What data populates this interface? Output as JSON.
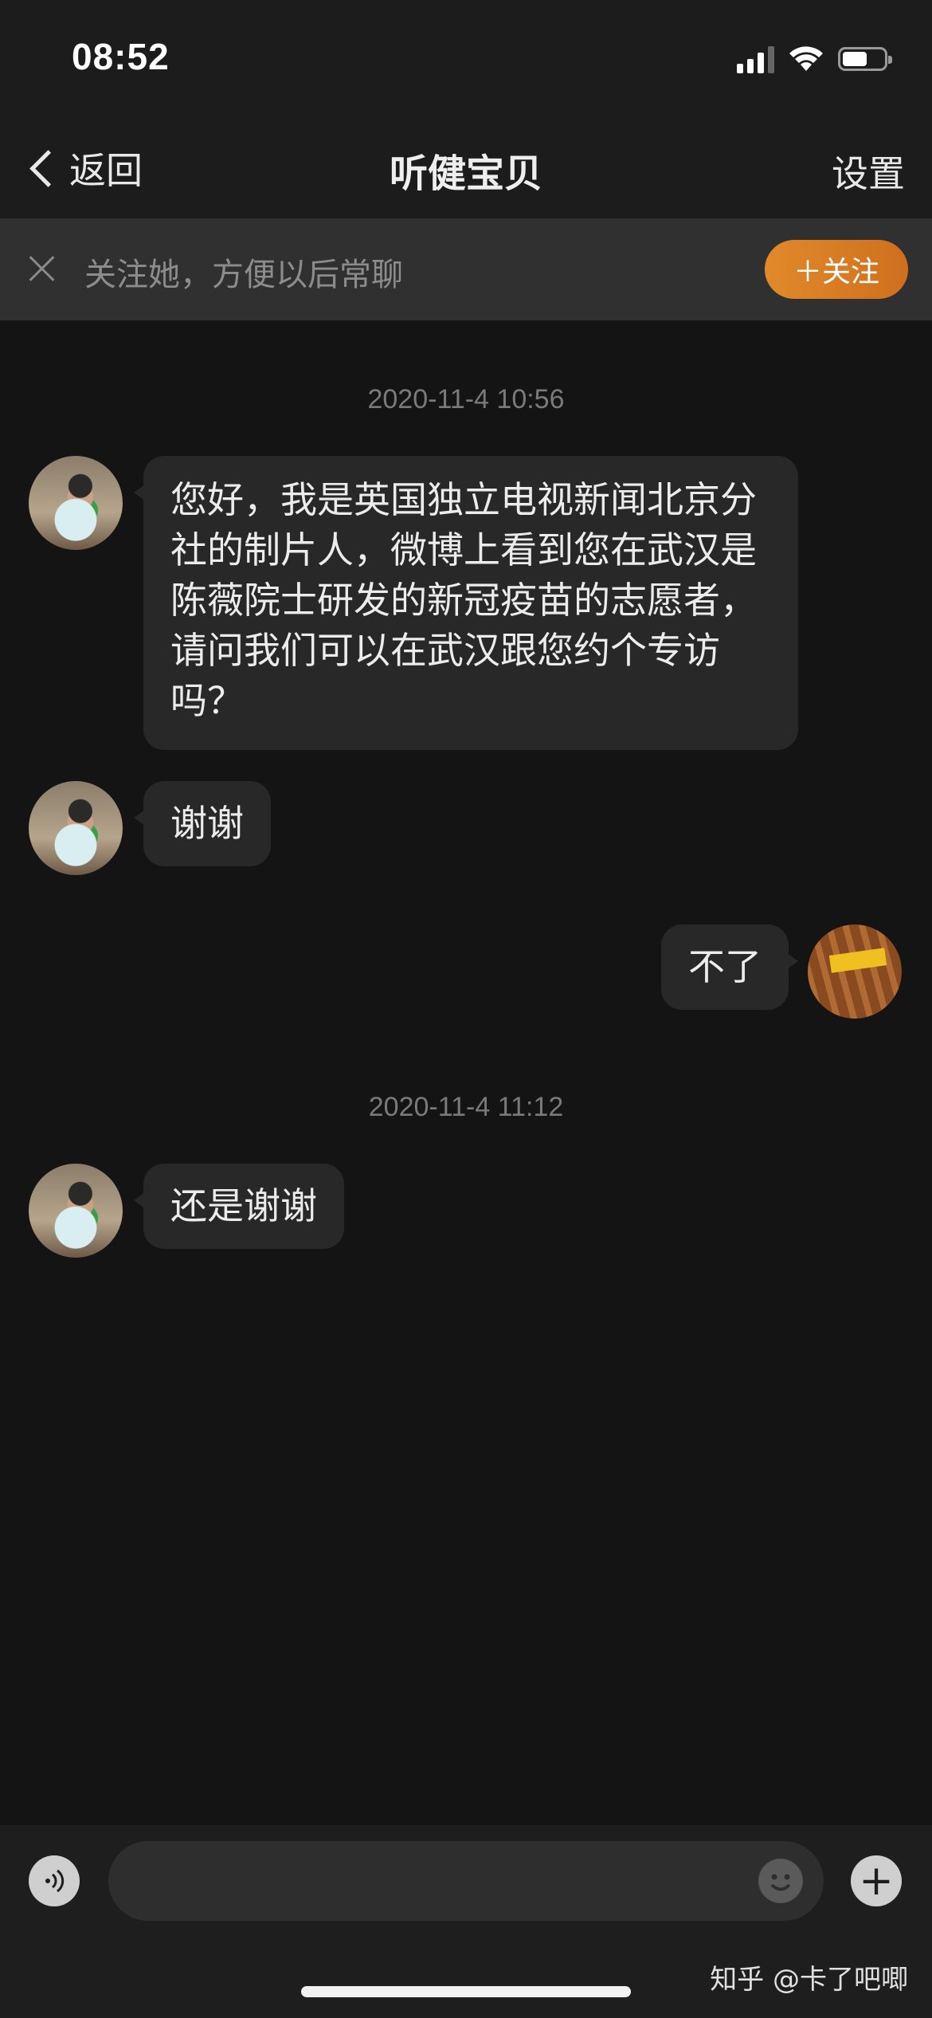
{
  "status_bar": {
    "time": "08:52",
    "signal_bars": 3,
    "signal_max": 4,
    "battery_level": 0.6
  },
  "nav": {
    "back_label": "返回",
    "title": "听健宝贝",
    "settings_label": "设置"
  },
  "follow_banner": {
    "text": "关注她，方便以后常聊",
    "button_label": "＋关注"
  },
  "messages": {
    "timestamp_1": "2020-11-4 10:56",
    "msg_1": "您好，我是英国独立电视新闻北京分社的制片人，微博上看到您在武汉是陈薇院士研发的新冠疫苗的志愿者，请问我们可以在武汉跟您约个专访吗？",
    "msg_2": "谢谢",
    "msg_3": "不了",
    "timestamp_2": "2020-11-4 11:12",
    "msg_4": "还是谢谢"
  },
  "input_bar": {
    "placeholder": "",
    "voice_icon": "voice-icon",
    "emoji_icon": "emoji-icon",
    "plus_icon": "plus-icon"
  },
  "watermark": "知乎 @卡了吧唧",
  "colors": {
    "background": "#141414",
    "bubble": "#282828",
    "follow_button": "#e08a2a"
  }
}
